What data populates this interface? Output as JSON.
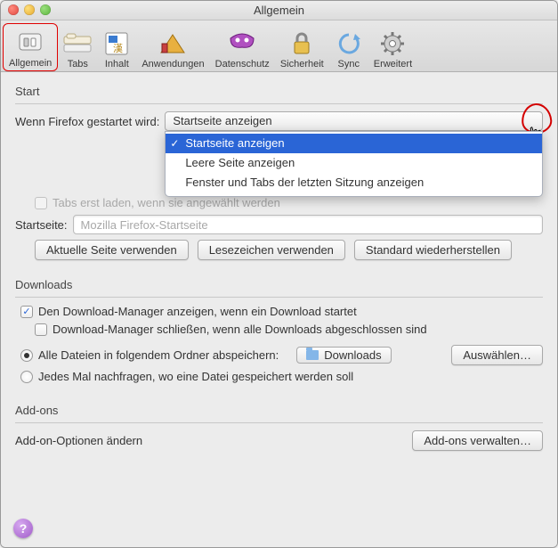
{
  "window": {
    "title": "Allgemein"
  },
  "toolbar": {
    "items": [
      {
        "label": "Allgemein",
        "icon": "general-switch-icon"
      },
      {
        "label": "Tabs",
        "icon": "tabs-icon"
      },
      {
        "label": "Inhalt",
        "icon": "content-icon"
      },
      {
        "label": "Anwendungen",
        "icon": "applications-icon"
      },
      {
        "label": "Datenschutz",
        "icon": "privacy-mask-icon"
      },
      {
        "label": "Sicherheit",
        "icon": "lock-icon"
      },
      {
        "label": "Sync",
        "icon": "sync-icon"
      },
      {
        "label": "Erweitert",
        "icon": "gear-icon"
      }
    ]
  },
  "start": {
    "section_label": "Start",
    "when_start_label": "Wenn Firefox gestartet wird:",
    "when_start_value": "Startseite anzeigen",
    "options": [
      "Startseite anzeigen",
      "Leere Seite anzeigen",
      "Fenster und Tabs der letzten Sitzung anzeigen"
    ],
    "tabs_on_demand_label": "Tabs erst laden, wenn sie angewählt werden",
    "homepage_label": "Startseite:",
    "homepage_value": "Mozilla Firefox-Startseite",
    "use_current_btn": "Aktuelle Seite verwenden",
    "use_bookmarks_btn": "Lesezeichen verwenden",
    "restore_default_btn": "Standard wiederherstellen"
  },
  "downloads": {
    "section_label": "Downloads",
    "show_dl_manager_label": "Den Download-Manager anzeigen, wenn ein Download startet",
    "close_when_done_label": "Download-Manager schließen, wenn alle Downloads abgeschlossen sind",
    "save_to_folder_label": "Alle Dateien in folgendem Ordner abspeichern:",
    "folder_name": "Downloads",
    "choose_btn": "Auswählen…",
    "ask_every_time_label": "Jedes Mal nachfragen, wo eine Datei gespeichert werden soll"
  },
  "addons": {
    "section_label": "Add-ons",
    "change_addon_options_label": "Add-on-Optionen ändern",
    "manage_addons_btn": "Add-ons verwalten…"
  }
}
